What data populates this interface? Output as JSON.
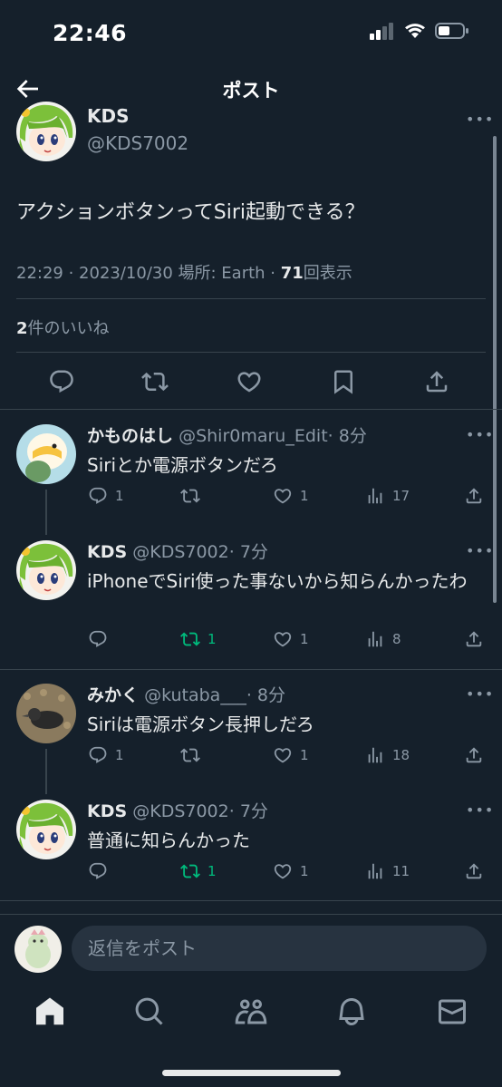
{
  "status_bar": {
    "time": "22:46"
  },
  "header": {
    "title": "ポスト"
  },
  "main_post": {
    "author_name": "KDS",
    "author_handle": "@KDS7002",
    "text": "アクションボタンってSiri起動できる？",
    "meta_prefix": "22:29 · 2023/10/30 場所: Earth · ",
    "views_count": "71",
    "views_label": "回表示",
    "likes_count": "2",
    "likes_label": "件のいいね"
  },
  "replies": [
    {
      "name": "かものはし",
      "handle": "@Shir0maru_Edit",
      "time": "· 8分",
      "text": "Siriとか電源ボタンだろ",
      "replies": "1",
      "retweets": "",
      "likes": "1",
      "views": "17"
    },
    {
      "name": "KDS",
      "handle": "@KDS7002",
      "time": "· 7分",
      "text": "iPhoneでSiri使った事ないから知らんかったわ",
      "replies": "",
      "retweets": "1",
      "likes": "1",
      "views": "8"
    },
    {
      "name": "みかく",
      "handle": "@kutaba___",
      "time": "· 8分",
      "text": "Siriは電源ボタン長押しだろ",
      "replies": "1",
      "retweets": "",
      "likes": "1",
      "views": "18"
    },
    {
      "name": "KDS",
      "handle": "@KDS7002",
      "time": "· 7分",
      "text": "普通に知らんかった",
      "replies": "",
      "retweets": "1",
      "likes": "1",
      "views": "11"
    }
  ],
  "composer": {
    "placeholder": "返信をポスト"
  },
  "tabs": [
    "home-icon",
    "search-icon",
    "communities-icon",
    "notifications-icon",
    "messages-icon"
  ],
  "colors": {
    "background": "#15202b",
    "divider": "#38444d",
    "muted": "#8b98a5",
    "retweet_active": "#00ba7c",
    "input_bg": "#273340"
  }
}
